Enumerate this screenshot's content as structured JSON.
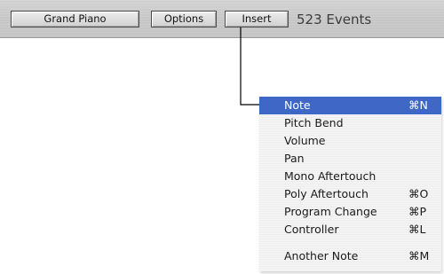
{
  "toolbar": {
    "instrument_label": "Grand Piano",
    "options_label": "Options",
    "insert_label": "Insert",
    "event_count": "523 Events"
  },
  "menu": {
    "items": [
      {
        "label": "Note",
        "shortcut": "⌘N",
        "selected": true
      },
      {
        "label": "Pitch Bend",
        "shortcut": ""
      },
      {
        "label": "Volume",
        "shortcut": ""
      },
      {
        "label": "Pan",
        "shortcut": ""
      },
      {
        "label": "Mono Aftertouch",
        "shortcut": ""
      },
      {
        "label": "Poly Aftertouch",
        "shortcut": "⌘O"
      },
      {
        "label": "Program Change",
        "shortcut": "⌘P"
      },
      {
        "label": "Controller",
        "shortcut": "⌘L"
      },
      {
        "label": "Another Note",
        "shortcut": "⌘M"
      }
    ]
  },
  "colors": {
    "selection": "#3f68c6",
    "toolbar": "#c8c8c8",
    "callout_line": "#000000"
  }
}
